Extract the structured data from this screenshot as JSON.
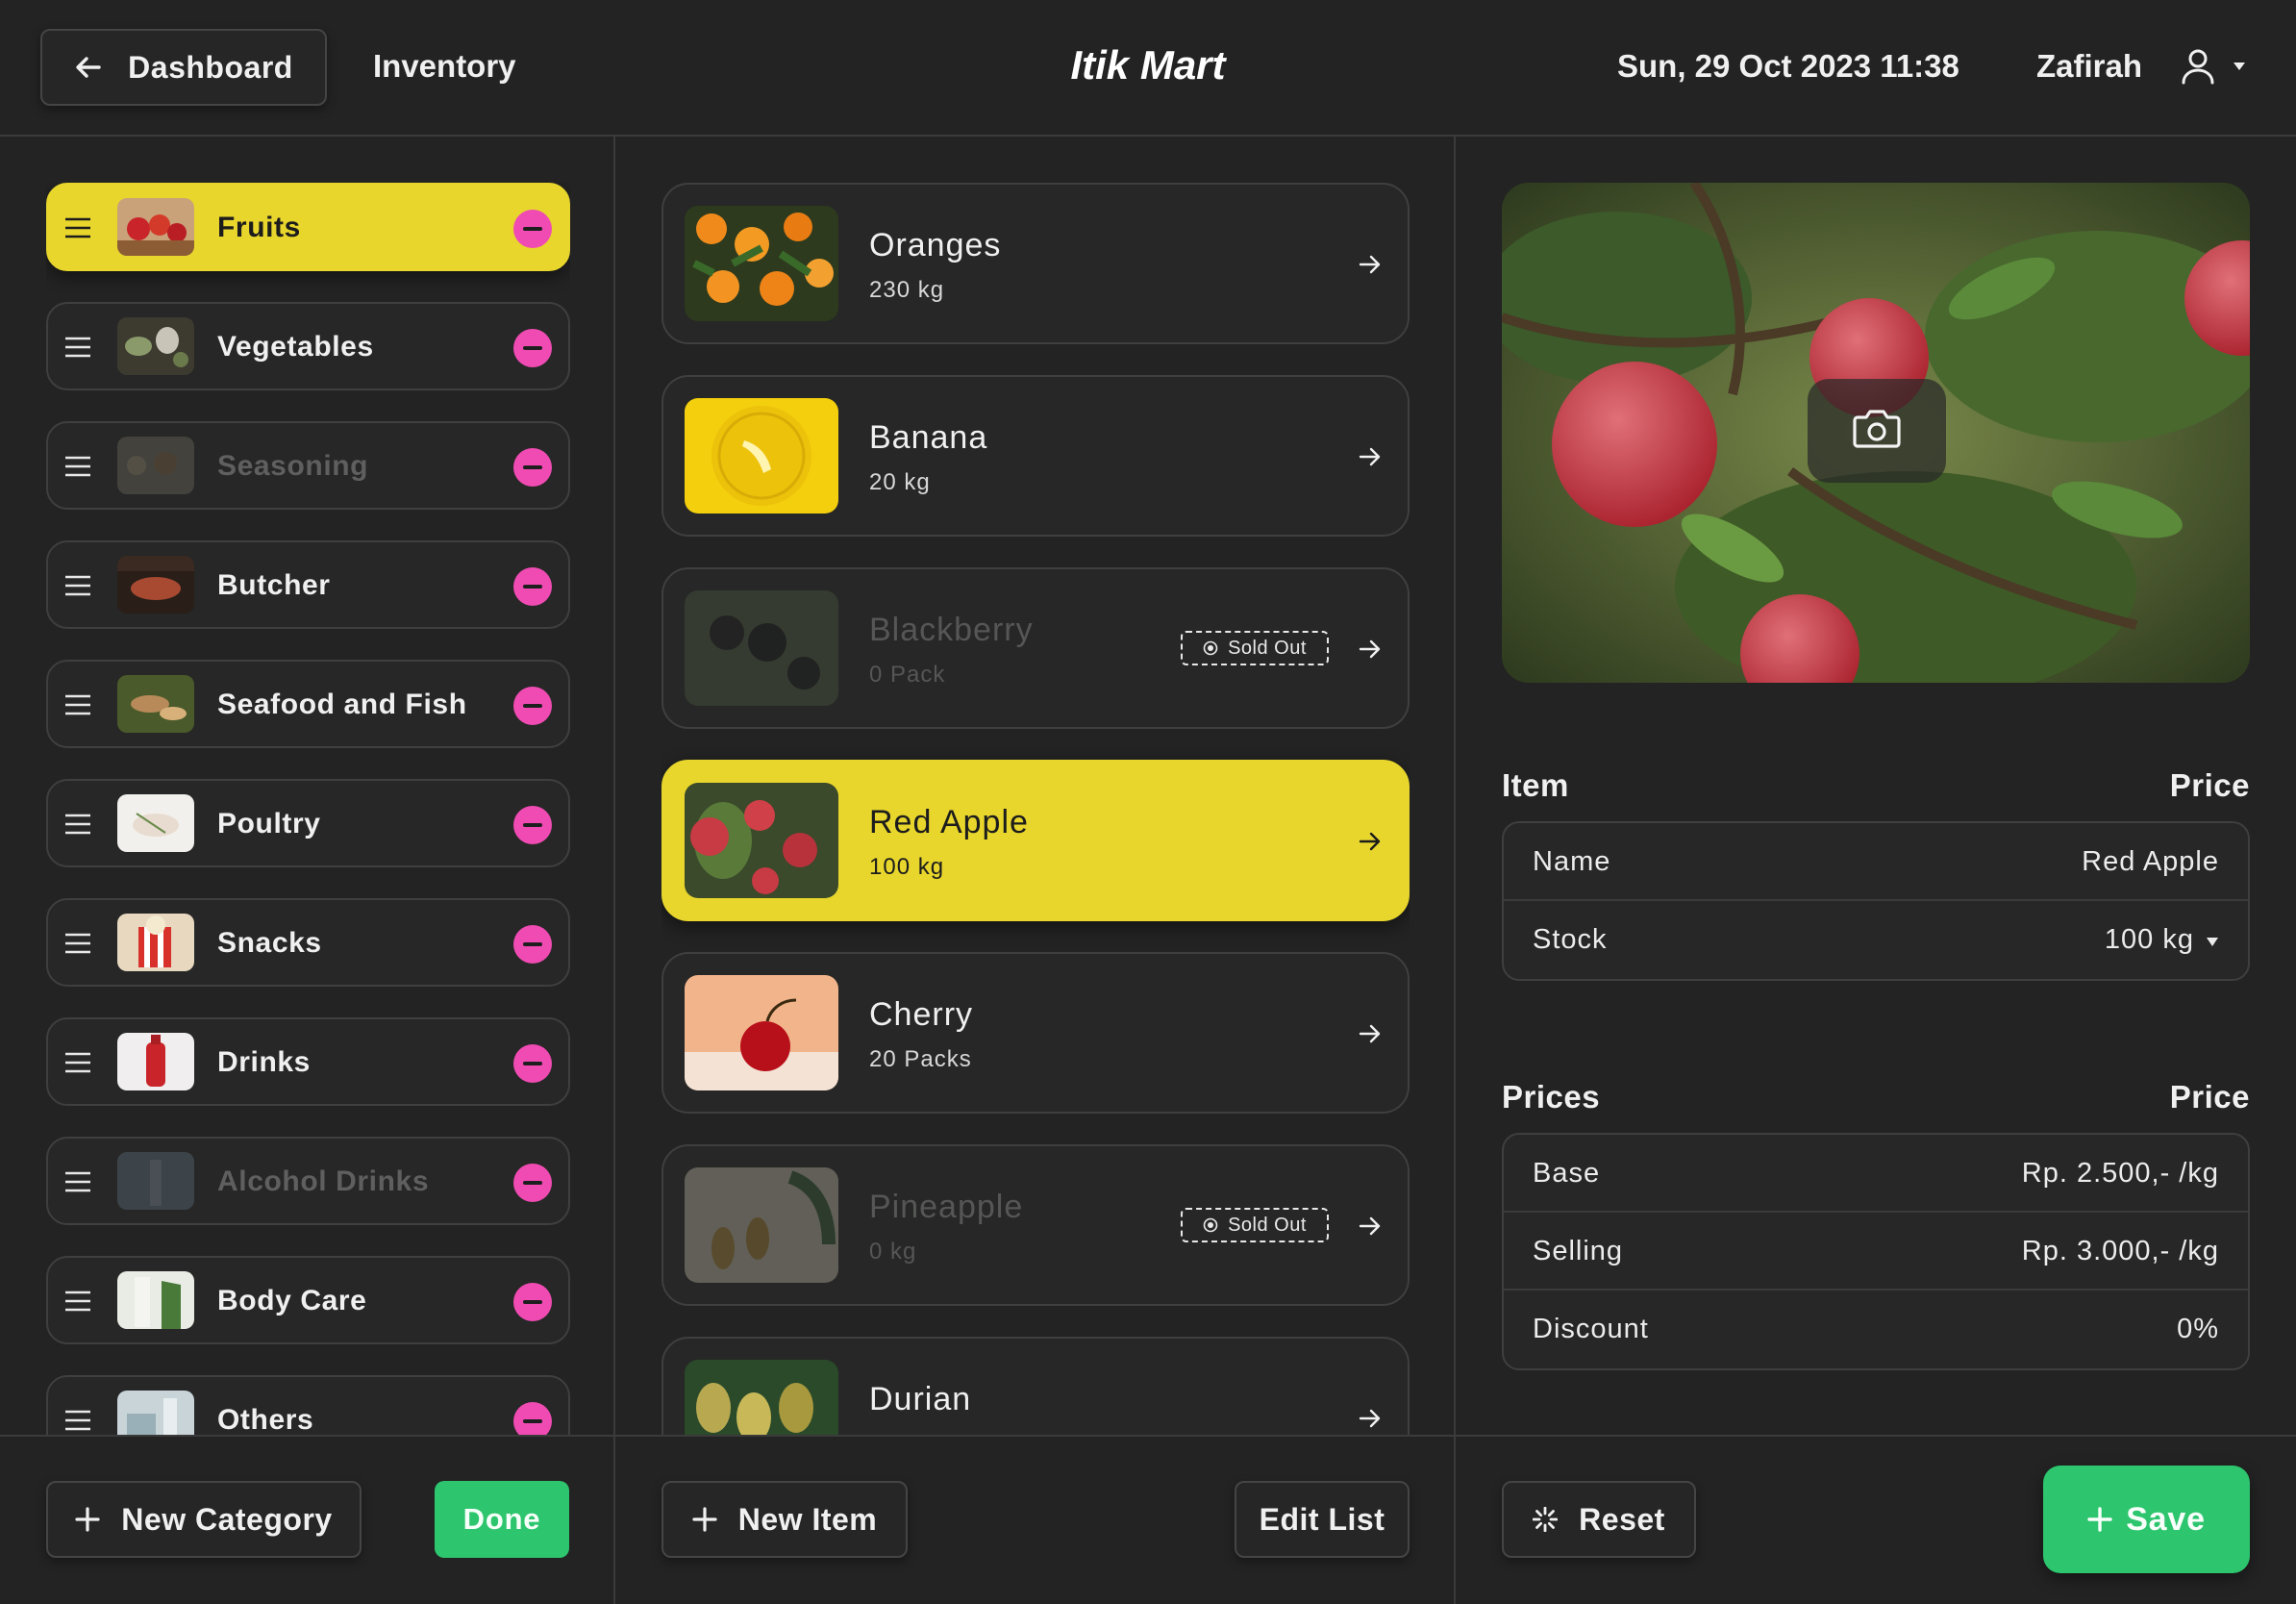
{
  "header": {
    "back_label": "Dashboard",
    "inventory_label": "Inventory",
    "app_title": "Itik Mart",
    "datetime": "Sun, 29 Oct 2023 11:38",
    "username": "Zafirah"
  },
  "categories": [
    {
      "label": "Fruits",
      "state": "active"
    },
    {
      "label": "Vegetables",
      "state": "normal"
    },
    {
      "label": "Seasoning",
      "state": "disabled"
    },
    {
      "label": "Butcher",
      "state": "normal"
    },
    {
      "label": "Seafood and Fish",
      "state": "normal"
    },
    {
      "label": "Poultry",
      "state": "normal"
    },
    {
      "label": "Snacks",
      "state": "normal"
    },
    {
      "label": "Drinks",
      "state": "normal"
    },
    {
      "label": "Alcohol Drinks",
      "state": "disabled"
    },
    {
      "label": "Body Care",
      "state": "normal"
    },
    {
      "label": "Others",
      "state": "normal"
    }
  ],
  "items": [
    {
      "name": "Oranges",
      "qty": "230 kg",
      "state": "normal"
    },
    {
      "name": "Banana",
      "qty": "20 kg",
      "state": "normal"
    },
    {
      "name": "Blackberry",
      "qty": "0 Pack",
      "state": "sold-out",
      "badge": "Sold Out"
    },
    {
      "name": "Red Apple",
      "qty": "100 kg",
      "state": "active"
    },
    {
      "name": "Cherry",
      "qty": "20 Packs",
      "state": "normal"
    },
    {
      "name": "Pineapple",
      "qty": "0 kg",
      "state": "sold-out",
      "badge": "Sold Out"
    },
    {
      "name": "Durian",
      "qty": "",
      "state": "normal"
    }
  ],
  "detail": {
    "item_section": {
      "title": "Item",
      "col": "Price"
    },
    "name_label": "Name",
    "name_value": "Red Apple",
    "stock_label": "Stock",
    "stock_value": "100  kg",
    "prices_section": {
      "title": "Prices",
      "col": "Price"
    },
    "base_label": "Base",
    "base_value": "Rp. 2.500,-  /kg",
    "selling_label": "Selling",
    "selling_value": "Rp. 3.000,-  /kg",
    "discount_label": "Discount",
    "discount_value": "0%"
  },
  "footer": {
    "new_category": "New Category",
    "done": "Done",
    "new_item": "New Item",
    "edit_list": "Edit List",
    "reset": "Reset",
    "save": "Save"
  },
  "colors": {
    "accent_yellow": "#e8d62c",
    "remove_pink": "#f04bb3",
    "save_green": "#2dc56e",
    "background": "#222322"
  },
  "icons": [
    "arrow-left-icon",
    "user-icon",
    "caret-down-icon",
    "drag-handle-icon",
    "remove-icon",
    "arrow-right-icon",
    "sold-out-icon",
    "camera-icon",
    "plus-icon",
    "reset-icon"
  ]
}
